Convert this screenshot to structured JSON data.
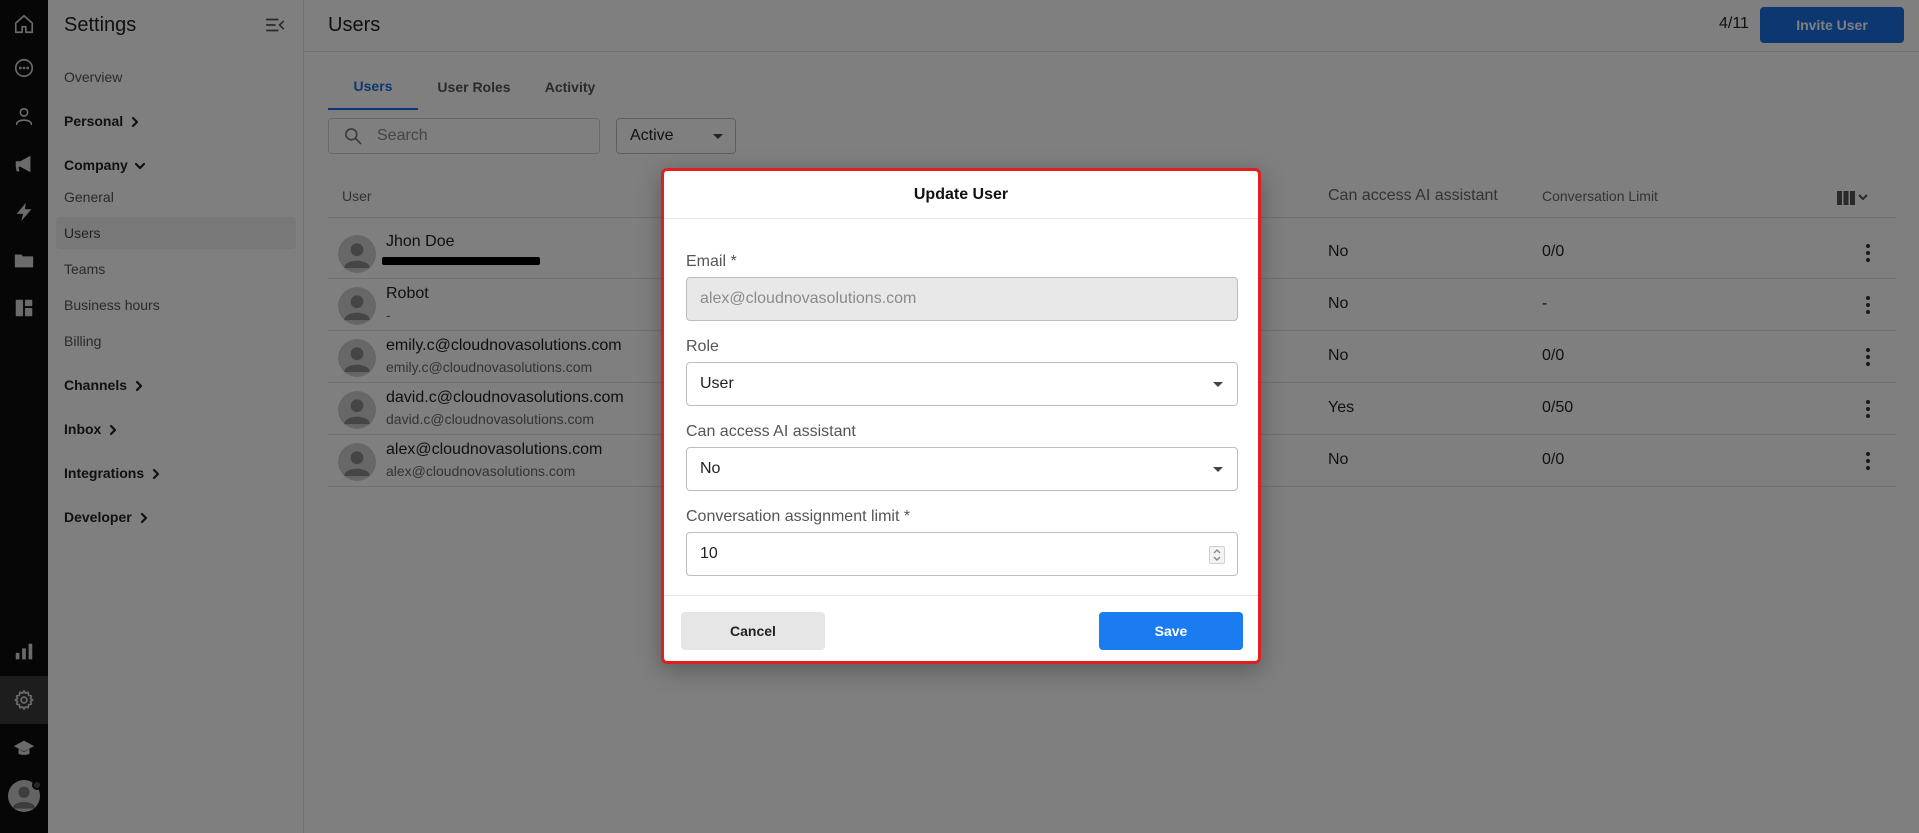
{
  "sidebar": {
    "title": "Settings",
    "items": {
      "overview": "Overview",
      "personal": "Personal",
      "company": "Company",
      "general": "General",
      "users": "Users",
      "teams": "Teams",
      "business_hours": "Business hours",
      "billing": "Billing",
      "channels": "Channels",
      "inbox": "Inbox",
      "integrations": "Integrations",
      "developer": "Developer"
    }
  },
  "header": {
    "title": "Users",
    "seat_count": "4/11",
    "invite_label": "Invite User"
  },
  "tabs": [
    "Users",
    "User Roles",
    "Activity"
  ],
  "filters": {
    "search_placeholder": "Search",
    "status_value": "Active"
  },
  "table": {
    "headers": {
      "user": "User",
      "ai": "Can access AI assistant",
      "limit": "Conversation Limit"
    },
    "rows": [
      {
        "name": "Jhon Doe",
        "email": "",
        "ai": "No",
        "limit": "0/0"
      },
      {
        "name": "Robot",
        "email": "-",
        "ai": "No",
        "limit": "-"
      },
      {
        "name": "emily.c@cloudnovasolutions.com",
        "email": "emily.c@cloudnovasolutions.com",
        "ai": "No",
        "limit": "0/0"
      },
      {
        "name": "david.c@cloudnovasolutions.com",
        "email": "david.c@cloudnovasolutions.com",
        "ai": "Yes",
        "limit": "0/50"
      },
      {
        "name": "alex@cloudnovasolutions.com",
        "email": "alex@cloudnovasolutions.com",
        "ai": "No",
        "limit": "0/0"
      }
    ]
  },
  "modal": {
    "title": "Update User",
    "email_label": "Email",
    "email_value": "alex@cloudnovasolutions.com",
    "role_label": "Role",
    "role_value": "User",
    "ai_label": "Can access AI assistant",
    "ai_value": "No",
    "limit_label": "Conversation assignment limit",
    "limit_value": "10",
    "required_mark": "*",
    "cancel_label": "Cancel",
    "save_label": "Save"
  },
  "colors": {
    "accent": "#1a6fe0",
    "save": "#1a7cf0",
    "modal_border": "#e02020",
    "rail": "#0c0c0c"
  }
}
